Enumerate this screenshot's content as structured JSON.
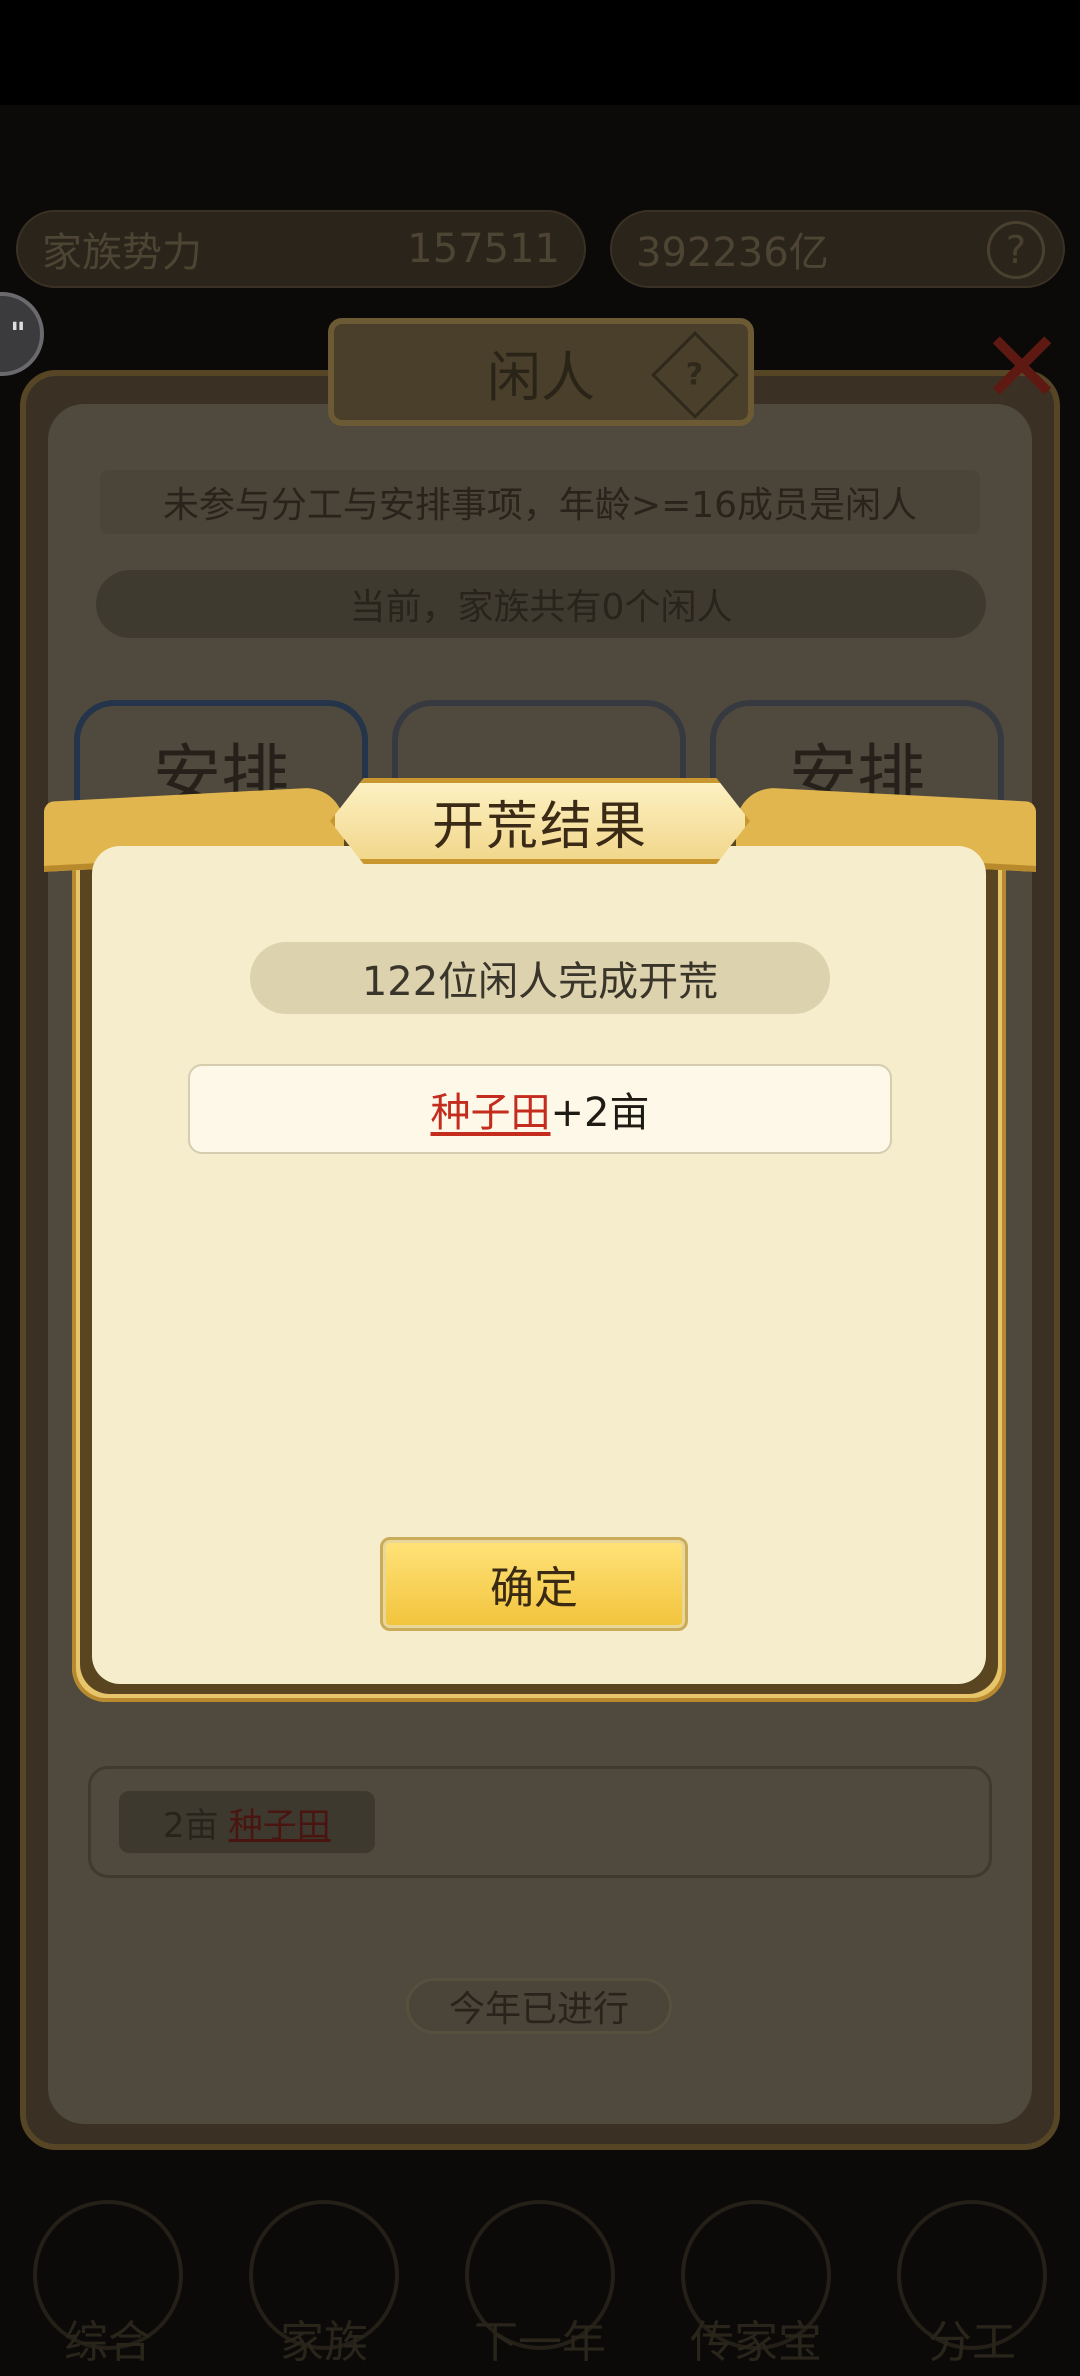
{
  "background": {
    "stats_left": {
      "label": "家族势力",
      "value": "157511"
    },
    "stats_right": {
      "value": "392236亿"
    },
    "panel_title": "闲人",
    "description": "未参与分工与安排事项，年龄>=16成员是闲人",
    "idle_count_text": "当前，家族共有0个闲人",
    "cards": [
      "安排",
      "",
      "安排"
    ],
    "harvest": {
      "amount": "2亩",
      "link": "种子田"
    },
    "year_button": "今年已进行",
    "nav": [
      "综合",
      "家族",
      "下一年",
      "传家宝",
      "分工"
    ]
  },
  "modal": {
    "title": "开荒结果",
    "result_text": "122位闲人完成开荒",
    "reward": {
      "link": "种子田",
      "suffix": "+2亩"
    },
    "confirm_label": "确定"
  },
  "icons": {
    "help": "question-mark-icon",
    "close": "close-icon",
    "chat": "chat-bubble-icon"
  },
  "colors": {
    "modal_bg": "#f5edcb",
    "gold": "#e7c56b",
    "link_red": "#c42c1e",
    "button_yellow": "#f2c33b"
  }
}
